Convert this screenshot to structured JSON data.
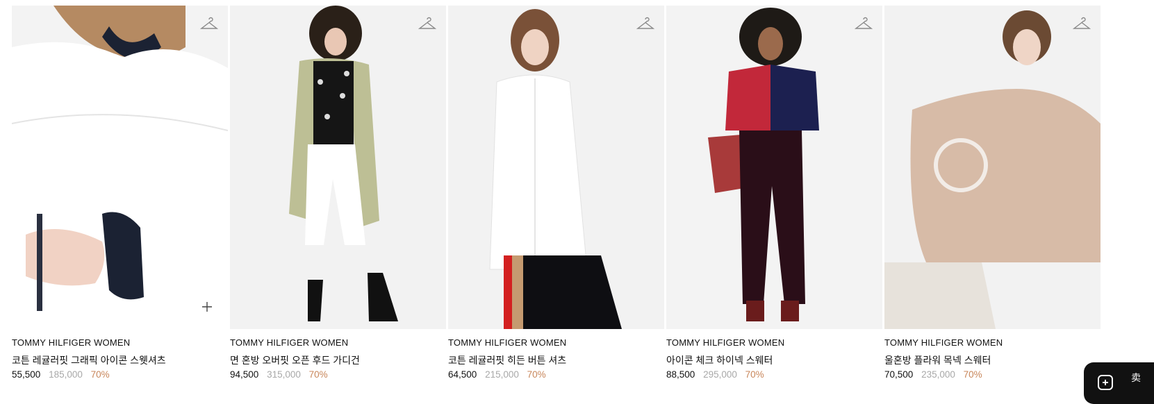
{
  "products": [
    {
      "brand": "TOMMY HILFIGER WOMEN",
      "name": "코튼 레귤러핏 그래픽 아이콘 스웻셔츠",
      "price": "55,500",
      "original_price": "185,000",
      "discount": "70%"
    },
    {
      "brand": "TOMMY HILFIGER WOMEN",
      "name": "면 혼방 오버핏 오픈 후드 가디건",
      "price": "94,500",
      "original_price": "315,000",
      "discount": "70%"
    },
    {
      "brand": "TOMMY HILFIGER WOMEN",
      "name": "코튼 레귤러핏 히든 버튼 셔츠",
      "price": "64,500",
      "original_price": "215,000",
      "discount": "70%"
    },
    {
      "brand": "TOMMY HILFIGER WOMEN",
      "name": "아이콘 체크 하이넥 스웨터",
      "price": "88,500",
      "original_price": "295,000",
      "discount": "70%"
    },
    {
      "brand": "TOMMY HILFIGER WOMEN",
      "name": "울혼방 플라워 목넥 스웨터",
      "price": "70,500",
      "original_price": "235,000",
      "discount": "70%"
    }
  ],
  "floating_button": {
    "label": "卖"
  },
  "icons": {
    "hanger": "hanger-icon",
    "plus": "plus-icon",
    "chat": "chat-icon"
  },
  "colors": {
    "discount": "#c8865a",
    "original_price": "#a8a8a8",
    "image_bg": "#f1f1f1"
  }
}
